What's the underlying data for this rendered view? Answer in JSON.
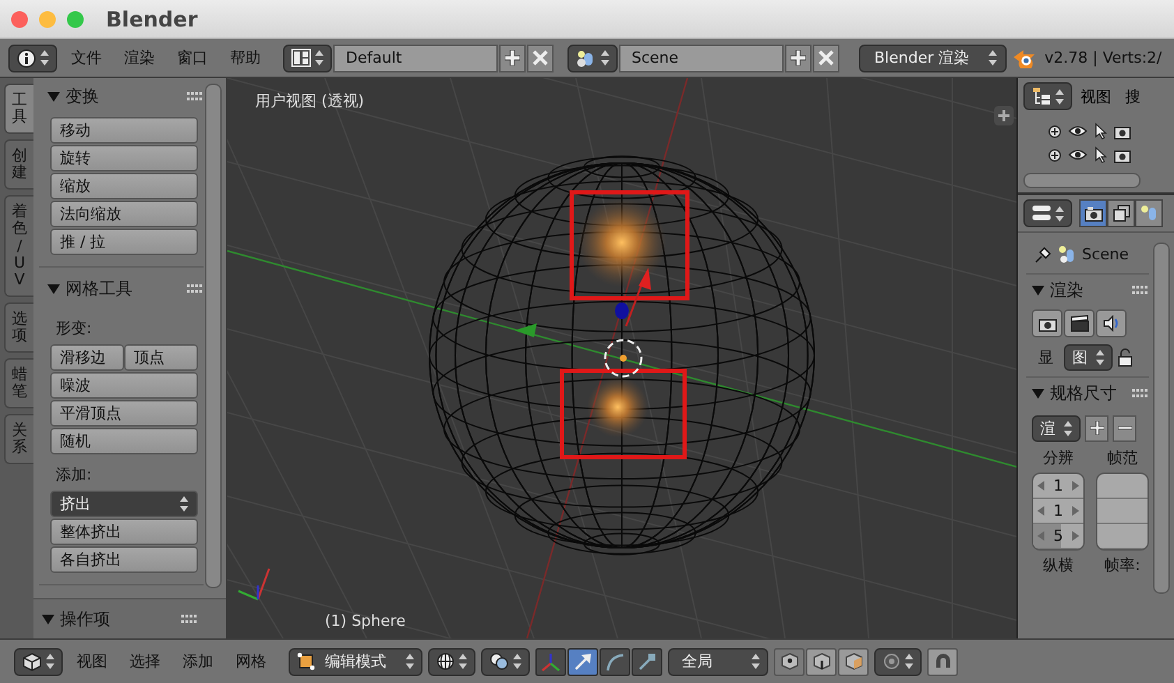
{
  "window": {
    "title": "Blender"
  },
  "top_header": {
    "menus": [
      "文件",
      "渲染",
      "窗口",
      "帮助"
    ],
    "layout": "Default",
    "scene": "Scene",
    "engine": "Blender 渲染",
    "stats": "v2.78 | Verts:2/"
  },
  "tool_tabs": [
    {
      "label": "工具",
      "selected": true
    },
    {
      "label": "创建",
      "selected": false
    },
    {
      "label": "着色 / UV",
      "selected": false
    },
    {
      "label": "选项",
      "selected": false
    },
    {
      "label": "蜡笔",
      "selected": false
    },
    {
      "label": "关系",
      "selected": false
    }
  ],
  "tool_shelf": {
    "panels": [
      {
        "title": "变换",
        "expanded": true,
        "items": [
          {
            "kind": "button",
            "label": "移动"
          },
          {
            "kind": "button",
            "label": "旋转"
          },
          {
            "kind": "button",
            "label": "缩放"
          },
          {
            "kind": "button",
            "label": "法向缩放"
          },
          {
            "kind": "button",
            "label": "推 / 拉"
          }
        ]
      },
      {
        "title": "网格工具",
        "expanded": true,
        "items": [
          {
            "kind": "label",
            "label": "形变:"
          },
          {
            "kind": "pair",
            "labels": [
              "滑移边",
              "顶点"
            ]
          },
          {
            "kind": "button",
            "label": "噪波"
          },
          {
            "kind": "button",
            "label": "平滑顶点"
          },
          {
            "kind": "button",
            "label": "随机"
          },
          {
            "kind": "label",
            "label": "添加:"
          },
          {
            "kind": "dropdown",
            "label": "挤出"
          },
          {
            "kind": "button",
            "label": "整体挤出"
          },
          {
            "kind": "button",
            "label": "各自挤出"
          }
        ]
      }
    ],
    "operator_panel": {
      "title": "操作项",
      "expanded": true
    }
  },
  "viewport": {
    "view_label": "用户视图 (透视)",
    "object_label": "(1) Sphere"
  },
  "outliner": {
    "menus": [
      "视图",
      "搜"
    ]
  },
  "properties": {
    "tabs": [
      {
        "kind": "render",
        "selected": true
      },
      {
        "kind": "layers",
        "selected": false
      },
      {
        "kind": "scene",
        "selected": false
      }
    ],
    "scene_name": "Scene",
    "render_panel": {
      "title": "渲染",
      "expanded": true,
      "display_label": "显",
      "display_value": "图"
    },
    "dimensions_panel": {
      "title": "规格尺寸",
      "expanded": true,
      "preset": "渲",
      "resolution_label": "分辨",
      "resolution_fields": [
        {
          "value": "1"
        },
        {
          "value": "1"
        },
        {
          "value": "5",
          "level": 0.55
        }
      ],
      "frame_range_label": "帧范",
      "aspect_label": "纵横",
      "frame_rate_label": "帧率:"
    }
  },
  "bottom_header": {
    "menus": [
      "视图",
      "选择",
      "添加",
      "网格"
    ],
    "mode": "编辑模式",
    "manipulators": [
      {
        "kind": "axes",
        "selected": false
      },
      {
        "kind": "translate",
        "selected": true
      },
      {
        "kind": "rotate",
        "selected": false
      },
      {
        "kind": "scale",
        "selected": false
      }
    ],
    "orientation": "全局",
    "select_modes": [
      {
        "kind": "vertex",
        "selected": true
      },
      {
        "kind": "edge",
        "selected": false
      },
      {
        "kind": "face",
        "selected": false
      }
    ]
  }
}
